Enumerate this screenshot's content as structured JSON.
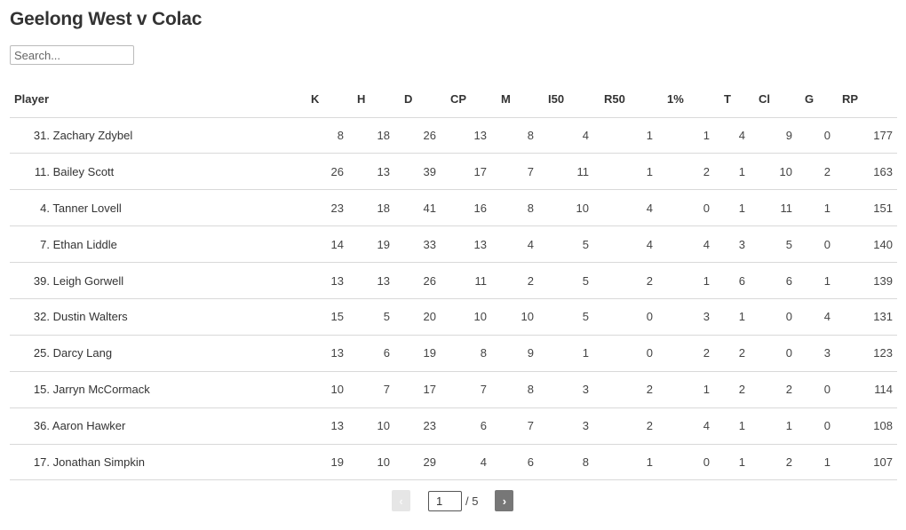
{
  "header": {
    "title": "Geelong West v Colac"
  },
  "search": {
    "placeholder": "Search...",
    "value": ""
  },
  "table": {
    "columns": [
      "Player",
      "K",
      "H",
      "D",
      "CP",
      "M",
      "I50",
      "R50",
      "1%",
      "T",
      "Cl",
      "G",
      "RP"
    ],
    "rows": [
      {
        "num": "31.",
        "name": "Zachary Zdybel",
        "K": "8",
        "H": "18",
        "D": "26",
        "CP": "13",
        "M": "8",
        "I50": "4",
        "R50": "1",
        "1%": "1",
        "T": "4",
        "Cl": "9",
        "G": "0",
        "RP": "177"
      },
      {
        "num": "11.",
        "name": "Bailey Scott",
        "K": "26",
        "H": "13",
        "D": "39",
        "CP": "17",
        "M": "7",
        "I50": "11",
        "R50": "1",
        "1%": "2",
        "T": "1",
        "Cl": "10",
        "G": "2",
        "RP": "163"
      },
      {
        "num": "4.",
        "name": "Tanner Lovell",
        "K": "23",
        "H": "18",
        "D": "41",
        "CP": "16",
        "M": "8",
        "I50": "10",
        "R50": "4",
        "1%": "0",
        "T": "1",
        "Cl": "11",
        "G": "1",
        "RP": "151"
      },
      {
        "num": "7.",
        "name": "Ethan Liddle",
        "K": "14",
        "H": "19",
        "D": "33",
        "CP": "13",
        "M": "4",
        "I50": "5",
        "R50": "4",
        "1%": "4",
        "T": "3",
        "Cl": "5",
        "G": "0",
        "RP": "140"
      },
      {
        "num": "39.",
        "name": "Leigh Gorwell",
        "K": "13",
        "H": "13",
        "D": "26",
        "CP": "11",
        "M": "2",
        "I50": "5",
        "R50": "2",
        "1%": "1",
        "T": "6",
        "Cl": "6",
        "G": "1",
        "RP": "139"
      },
      {
        "num": "32.",
        "name": "Dustin Walters",
        "K": "15",
        "H": "5",
        "D": "20",
        "CP": "10",
        "M": "10",
        "I50": "5",
        "R50": "0",
        "1%": "3",
        "T": "1",
        "Cl": "0",
        "G": "4",
        "RP": "131"
      },
      {
        "num": "25.",
        "name": "Darcy Lang",
        "K": "13",
        "H": "6",
        "D": "19",
        "CP": "8",
        "M": "9",
        "I50": "1",
        "R50": "0",
        "1%": "2",
        "T": "2",
        "Cl": "0",
        "G": "3",
        "RP": "123"
      },
      {
        "num": "15.",
        "name": "Jarryn McCormack",
        "K": "10",
        "H": "7",
        "D": "17",
        "CP": "7",
        "M": "8",
        "I50": "3",
        "R50": "2",
        "1%": "1",
        "T": "2",
        "Cl": "2",
        "G": "0",
        "RP": "114"
      },
      {
        "num": "36.",
        "name": "Aaron Hawker",
        "K": "13",
        "H": "10",
        "D": "23",
        "CP": "6",
        "M": "7",
        "I50": "3",
        "R50": "2",
        "1%": "4",
        "T": "1",
        "Cl": "1",
        "G": "0",
        "RP": "108"
      },
      {
        "num": "17.",
        "name": "Jonathan Simpkin",
        "K": "19",
        "H": "10",
        "D": "29",
        "CP": "4",
        "M": "6",
        "I50": "8",
        "R50": "1",
        "1%": "0",
        "T": "1",
        "Cl": "2",
        "G": "1",
        "RP": "107"
      }
    ]
  },
  "pagination": {
    "prev_icon": "‹",
    "next_icon": "›",
    "current_page": "1",
    "total_label": "/ 5",
    "prev_disabled": true
  }
}
